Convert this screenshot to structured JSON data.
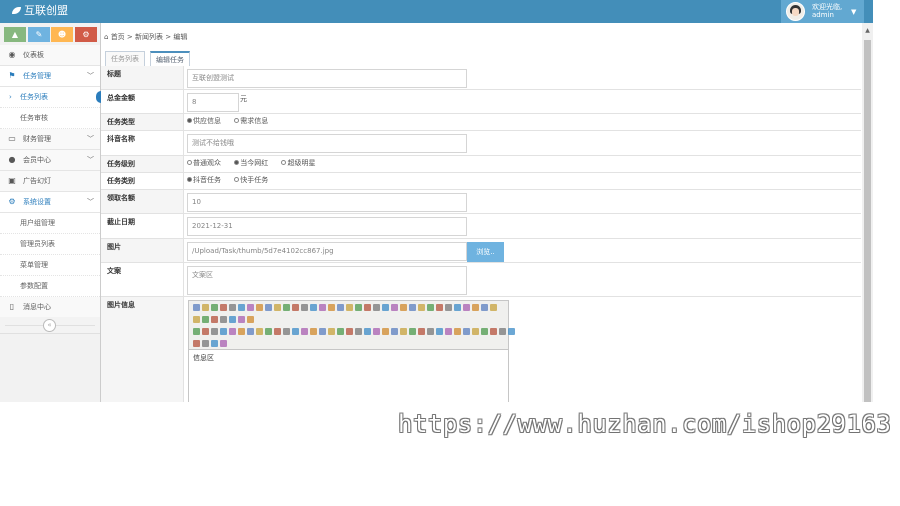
{
  "header": {
    "brand": "互联创盟",
    "welcome": "欢迎光临,",
    "username": "admin"
  },
  "sidebar": {
    "shortcuts": [
      {
        "icon": "signal-icon",
        "color": "#87b87f",
        "glyph": "▲"
      },
      {
        "icon": "pencil-icon",
        "color": "#6fb3e0",
        "glyph": "✎"
      },
      {
        "icon": "users-icon",
        "color": "#ffb752",
        "glyph": "☻"
      },
      {
        "icon": "cogs-icon",
        "color": "#d15b47",
        "glyph": "⚙"
      }
    ],
    "items": [
      {
        "label": "仪表板",
        "icon": "dashboard-icon",
        "glyph": "◉",
        "has_caret": false
      },
      {
        "label": "任务管理",
        "icon": "flag-icon",
        "glyph": "⚑",
        "has_caret": true,
        "open": true
      },
      {
        "label": "财务管理",
        "icon": "desktop-icon",
        "glyph": "▭",
        "has_caret": true
      },
      {
        "label": "会员中心",
        "icon": "user-icon",
        "glyph": "●",
        "has_caret": true
      },
      {
        "label": "广告幻灯",
        "icon": "picture-icon",
        "glyph": "▣",
        "has_caret": false
      },
      {
        "label": "系统设置",
        "icon": "gear-icon",
        "glyph": "⚙",
        "has_caret": true,
        "open": true
      },
      {
        "label": "消息中心",
        "icon": "bookmark-icon",
        "glyph": "▯",
        "has_caret": false
      }
    ],
    "task_sub": [
      {
        "label": "任务列表",
        "active": true
      },
      {
        "label": "任务审核",
        "active": false
      }
    ],
    "system_sub": [
      {
        "label": "用户组管理"
      },
      {
        "label": "管理员列表"
      },
      {
        "label": "菜单管理"
      },
      {
        "label": "参数配置"
      }
    ],
    "collapse_glyph": "«"
  },
  "breadcrumb": {
    "home": "首页",
    "sep": ">",
    "list": "新闻列表",
    "current": "编辑"
  },
  "tabs": [
    {
      "label": "任务列表",
      "active": false
    },
    {
      "label": "编辑任务",
      "active": true
    }
  ],
  "form": {
    "title_label": "标题",
    "title_value": "互联创盟测试",
    "amount_label": "总金金额",
    "amount_value": "8",
    "amount_unit": "元",
    "type_label": "任务类型",
    "type_options": [
      {
        "label": "供应信息",
        "checked": true
      },
      {
        "label": "需求信息",
        "checked": false
      }
    ],
    "douyin_label": "抖音名称",
    "douyin_value": "测试不给钱哦",
    "level_label": "任务级别",
    "level_options": [
      {
        "label": "普通观众",
        "checked": false
      },
      {
        "label": "当今网红",
        "checked": true
      },
      {
        "label": "超级明星",
        "checked": false
      }
    ],
    "category_label": "任务类别",
    "category_options": [
      {
        "label": "抖音任务",
        "checked": true
      },
      {
        "label": "快手任务",
        "checked": false
      }
    ],
    "quota_label": "领取名额",
    "quota_value": "10",
    "deadline_label": "截止日期",
    "deadline_value": "2021-12-31",
    "image_label": "图片",
    "image_value": "/Upload/Task/thumb/5d7e4102cc867.jpg",
    "browse_label": "浏览..",
    "copy_label": "文案",
    "copy_placeholder": "文案区",
    "info_label": "图片信息",
    "editor_content": "信息区"
  },
  "watermark": "https://www.huzhan.com/ishop29163"
}
